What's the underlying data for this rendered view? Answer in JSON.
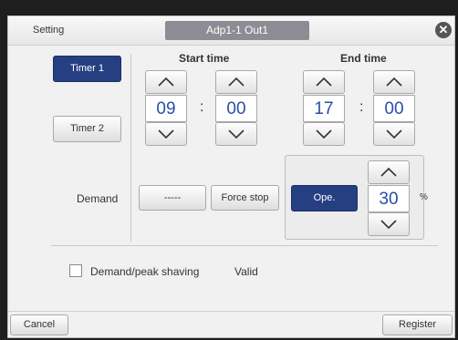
{
  "header": {
    "title": "Setting",
    "target": "Adp1-1 Out1",
    "close_icon": "close-icon"
  },
  "timers": [
    {
      "label": "Timer 1",
      "selected": true
    },
    {
      "label": "Timer 2",
      "selected": false
    }
  ],
  "start_time": {
    "label": "Start time",
    "hour": "09",
    "minute": "00"
  },
  "end_time": {
    "label": "End time",
    "hour": "17",
    "minute": "00"
  },
  "time_separator": ":",
  "demand": {
    "label": "Demand",
    "none_button": "-----",
    "force_stop_button": "Force stop",
    "ope_button": "Ope.",
    "percent_value": "30",
    "percent_unit": "%"
  },
  "peak_shaving": {
    "label": "Demand/peak shaving",
    "status": "Valid",
    "checked": false
  },
  "footer": {
    "cancel": "Cancel",
    "register": "Register"
  },
  "colors": {
    "selected": "#263f82",
    "value_text": "#284ea8"
  },
  "icons": {
    "up": "chevron-up-icon",
    "down": "chevron-down-icon"
  }
}
